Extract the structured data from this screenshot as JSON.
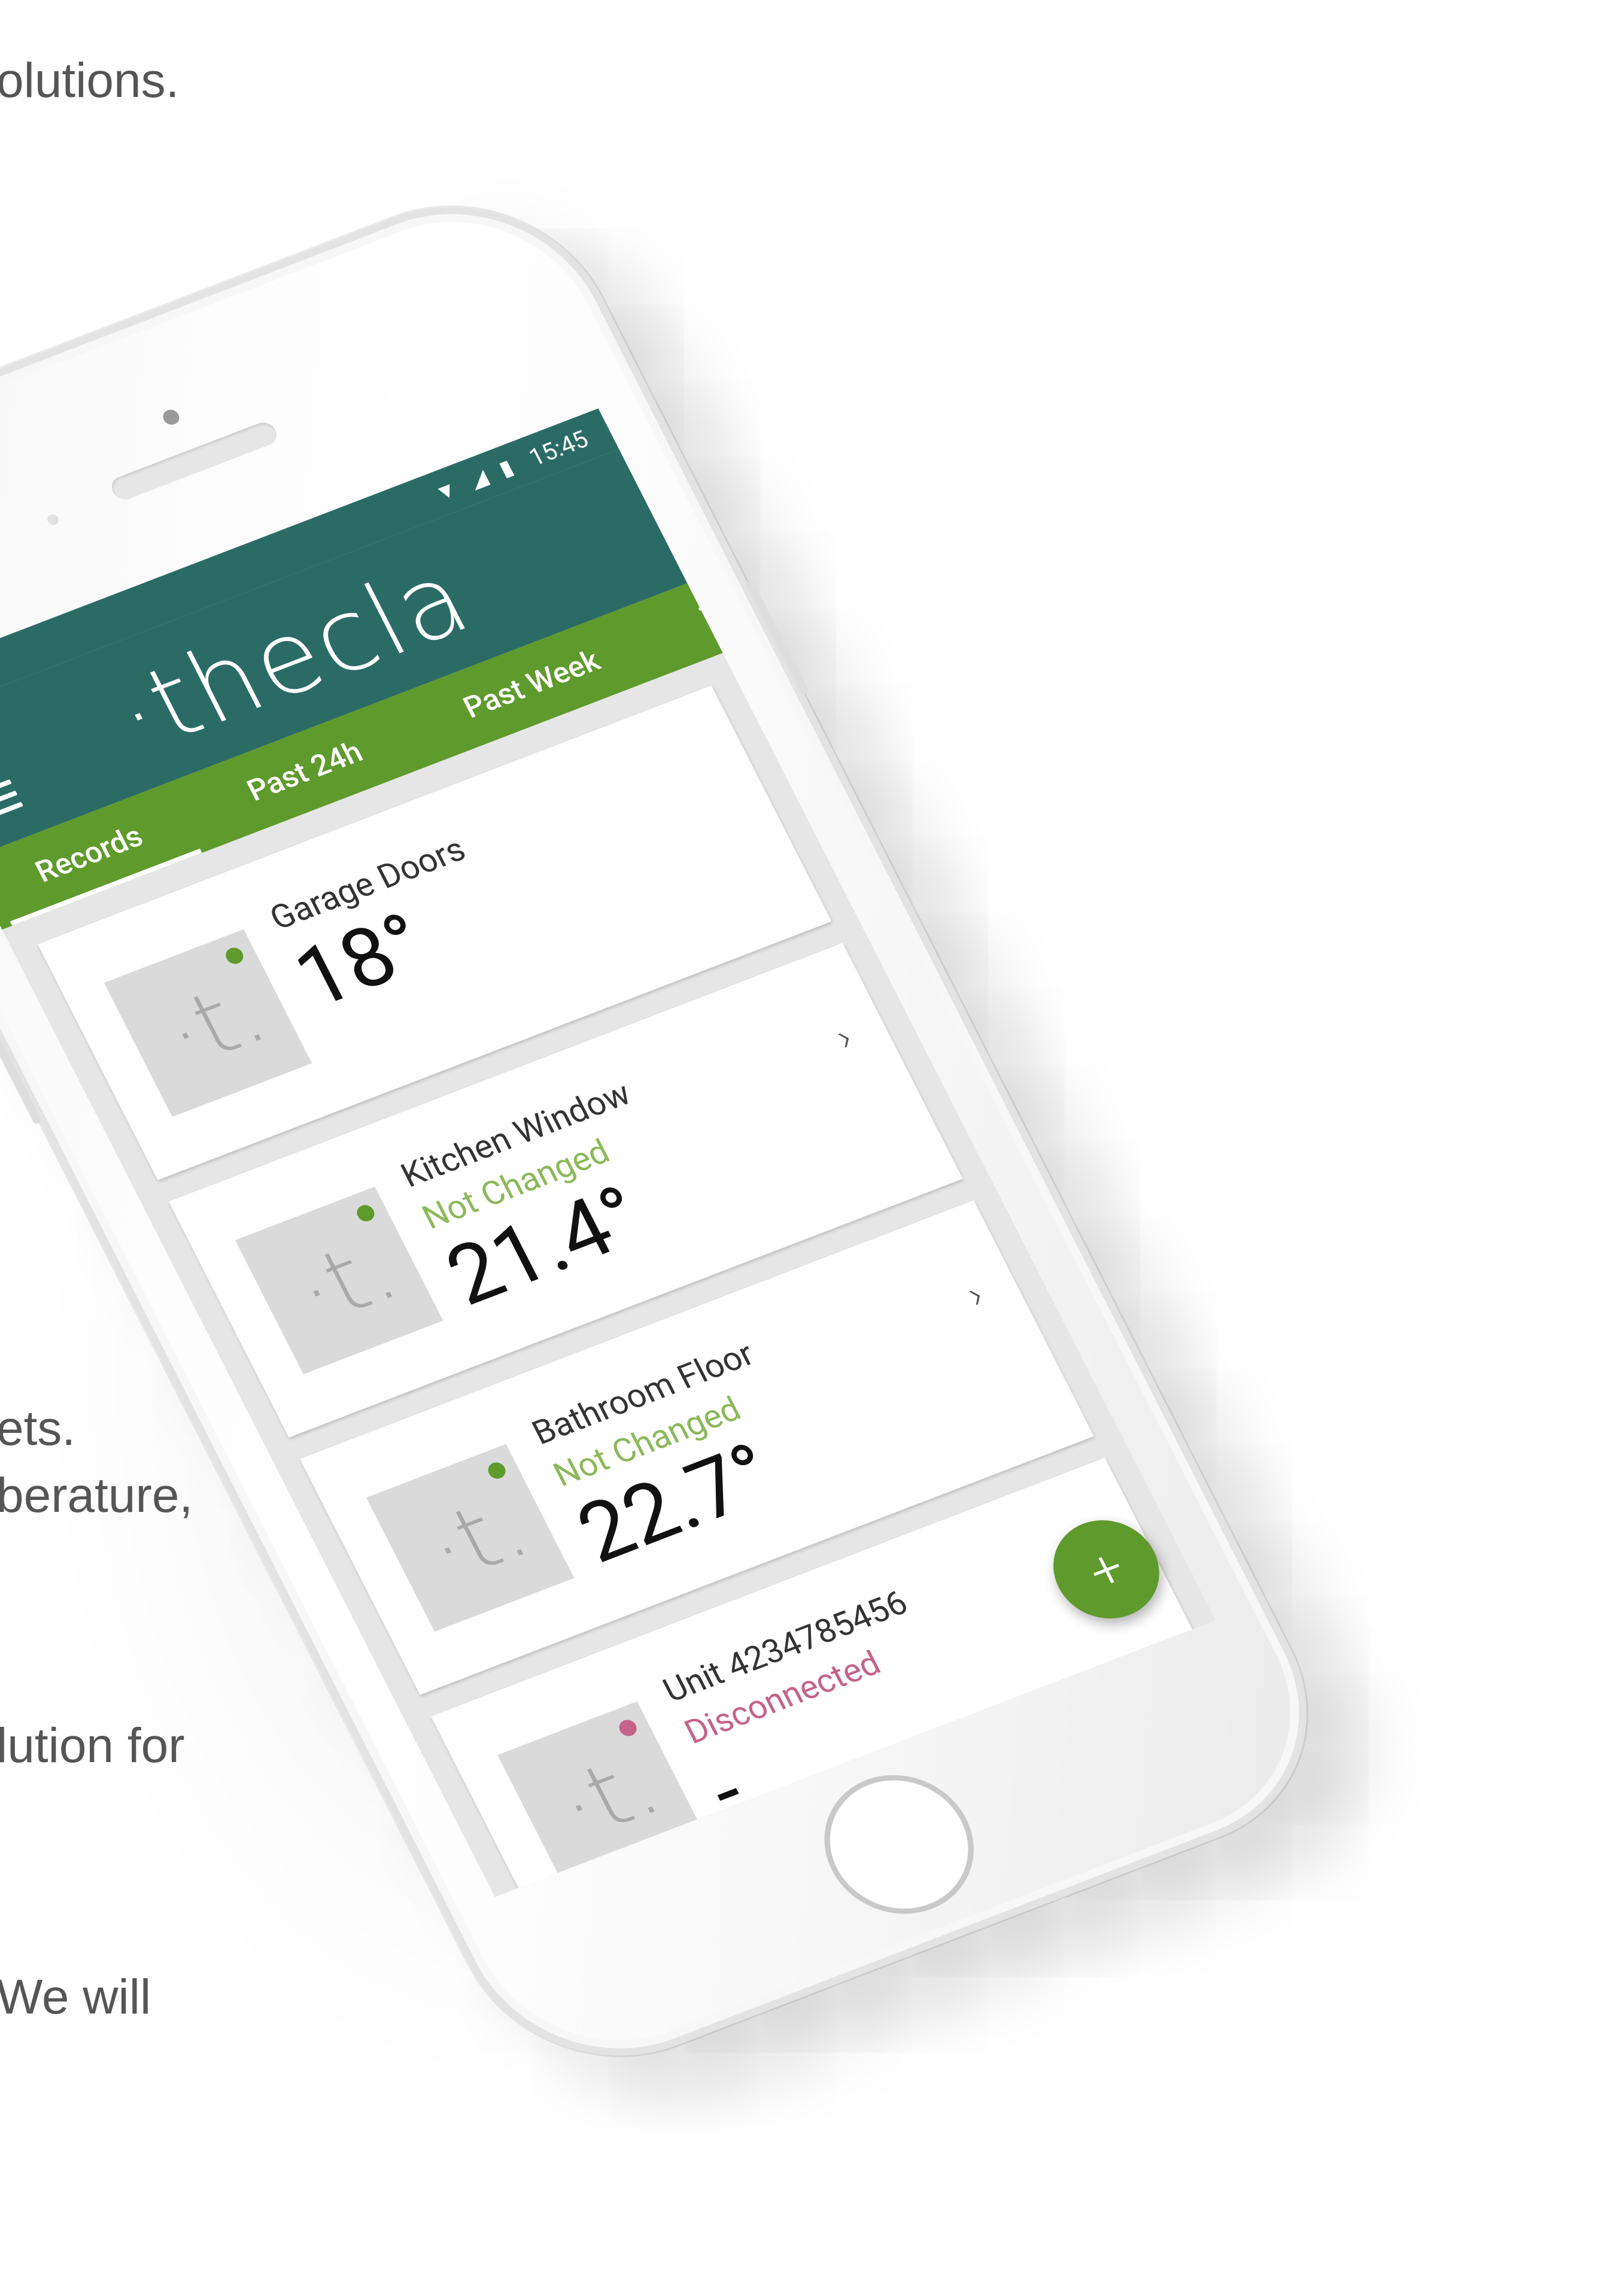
{
  "background_text": [
    "olutions.",
    "ets.",
    "berature,",
    "lution for",
    "We will"
  ],
  "status_bar": {
    "time": "15:45",
    "icons": [
      "wifi-icon",
      "signal-icon",
      "battery-icon"
    ]
  },
  "app": {
    "logo": "·thecla",
    "menu_icon": "hamburger-menu-icon"
  },
  "tabs": [
    {
      "label": "Records",
      "active": true
    },
    {
      "label": "Past 24h",
      "active": false
    },
    {
      "label": "Past Week",
      "active": false
    },
    {
      "label": "This Year",
      "active": false
    }
  ],
  "devices": [
    {
      "name": "Garage Doors",
      "status": "",
      "temperature": "18°",
      "indicator": "online"
    },
    {
      "name": "Kitchen Window",
      "status": "Not Changed",
      "temperature": "21.4°",
      "indicator": "online"
    },
    {
      "name": "Bathroom Floor",
      "status": "Not Changed",
      "temperature": "22.7°",
      "indicator": "online"
    },
    {
      "name": "Unit 4234785456",
      "status": "Disconnected",
      "temperature": "-",
      "indicator": "offline"
    }
  ],
  "device_thumb_glyph": "·t.",
  "chevron": "›",
  "fab": {
    "label": "+"
  },
  "colors": {
    "header_teal": "#2b6b66",
    "tab_green": "#5f9a2c",
    "status_ok": "#8cb85a",
    "status_disconnected": "#c4638a"
  }
}
